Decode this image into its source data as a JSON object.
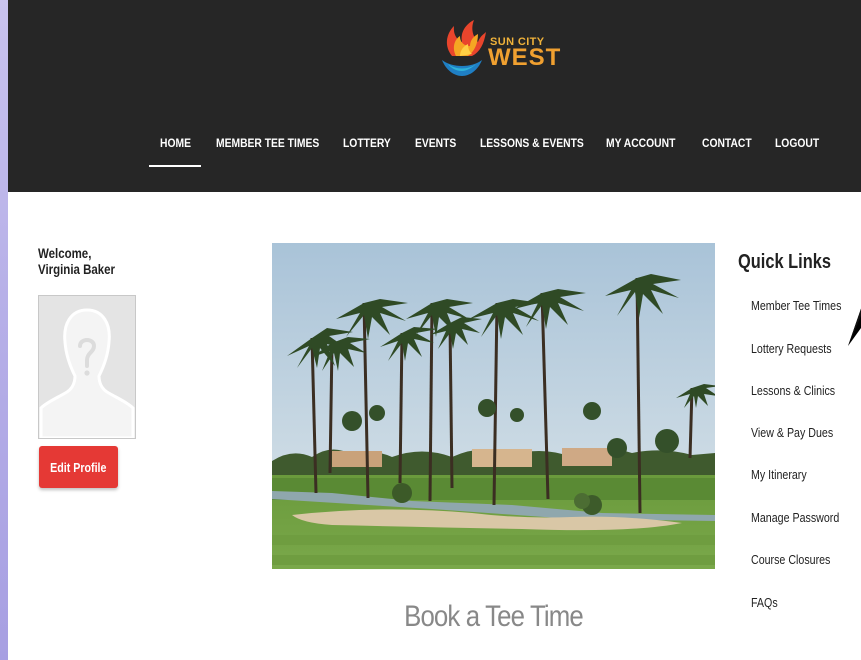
{
  "logo": {
    "line1": "SUN CITY",
    "line2": "WEST"
  },
  "nav": {
    "items": [
      "HOME",
      "MEMBER TEE TIMES",
      "LOTTERY",
      "EVENTS",
      "LESSONS & EVENTS",
      "MY ACCOUNT",
      "CONTACT",
      "LOGOUT"
    ],
    "active": "HOME"
  },
  "profile": {
    "welcome": "Welcome,",
    "name": "Virginia Baker",
    "edit_label": "Edit Profile"
  },
  "hero": {
    "cta": "Book a Tee Time"
  },
  "quick_links": {
    "title": "Quick Links",
    "items": [
      "Member Tee Times",
      "Lottery Requests",
      "Lessons & Clinics",
      "View & Pay Dues",
      "My Itinerary",
      "Manage Password",
      "Course Closures",
      "FAQs"
    ]
  },
  "colors": {
    "header_bg": "#262626",
    "accent_red": "#e53935",
    "logo_orange": "#f0a030",
    "logo_blue": "#1f7fc4"
  }
}
